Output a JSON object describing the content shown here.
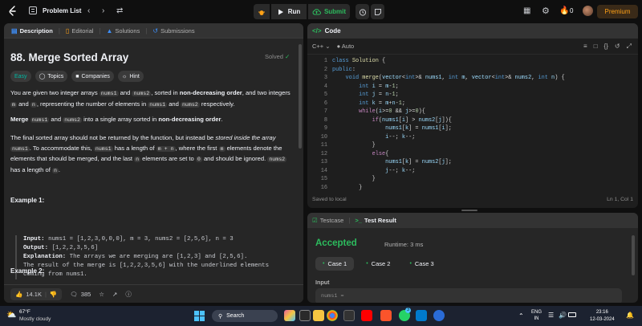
{
  "topnav": {
    "problem_list": "Problem List",
    "run": "Run",
    "submit": "Submit",
    "streak": "0",
    "premium": "Premium"
  },
  "left": {
    "tabs": [
      "Description",
      "Editorial",
      "Solutions",
      "Submissions"
    ],
    "title": "88. Merge Sorted Array",
    "solved": "Solved",
    "tags": [
      "Easy",
      "Topics",
      "Companies",
      "Hint"
    ],
    "example1_heading": "Example 1:",
    "example2_heading": "Example 2:",
    "ex1": {
      "input_label": "Input:",
      "input": "nums1 = [1,2,3,0,0,0], m = 3, nums2 = [2,5,6], n = 3",
      "output_label": "Output:",
      "output": "[1,2,2,3,5,6]",
      "explanation_label": "Explanation:",
      "explanation_1": "The arrays we are merging are [1,2,3] and [2,5,6].",
      "explanation_2": "The result of the merge is [1,2,2,3,5,6] with the underlined elements",
      "explanation_3": "coming from nums1."
    },
    "likes": "14.1K",
    "comments": "385"
  },
  "code": {
    "header": "Code",
    "language": "C++",
    "mode": "Auto",
    "saved": "Saved to local",
    "position": "Ln 1, Col 1",
    "line_numbers": [
      "1",
      "2",
      "3",
      "4",
      "5",
      "6",
      "7",
      "8",
      "9",
      "10",
      "11",
      "12",
      "13",
      "14",
      "15",
      "16"
    ]
  },
  "result": {
    "tab_testcase": "Testcase",
    "tab_result": "Test Result",
    "status": "Accepted",
    "runtime": "Runtime: 3 ms",
    "cases": [
      "Case 1",
      "Case 2",
      "Case 3"
    ],
    "input_label": "Input",
    "input_preview": "nums1 ="
  },
  "taskbar": {
    "temp": "67°F",
    "weather": "Mostly cloudy",
    "search": "Search",
    "lang_1": "ENG",
    "lang_2": "IN",
    "time": "23:16",
    "date": "12-03-2024",
    "badge": "3"
  }
}
